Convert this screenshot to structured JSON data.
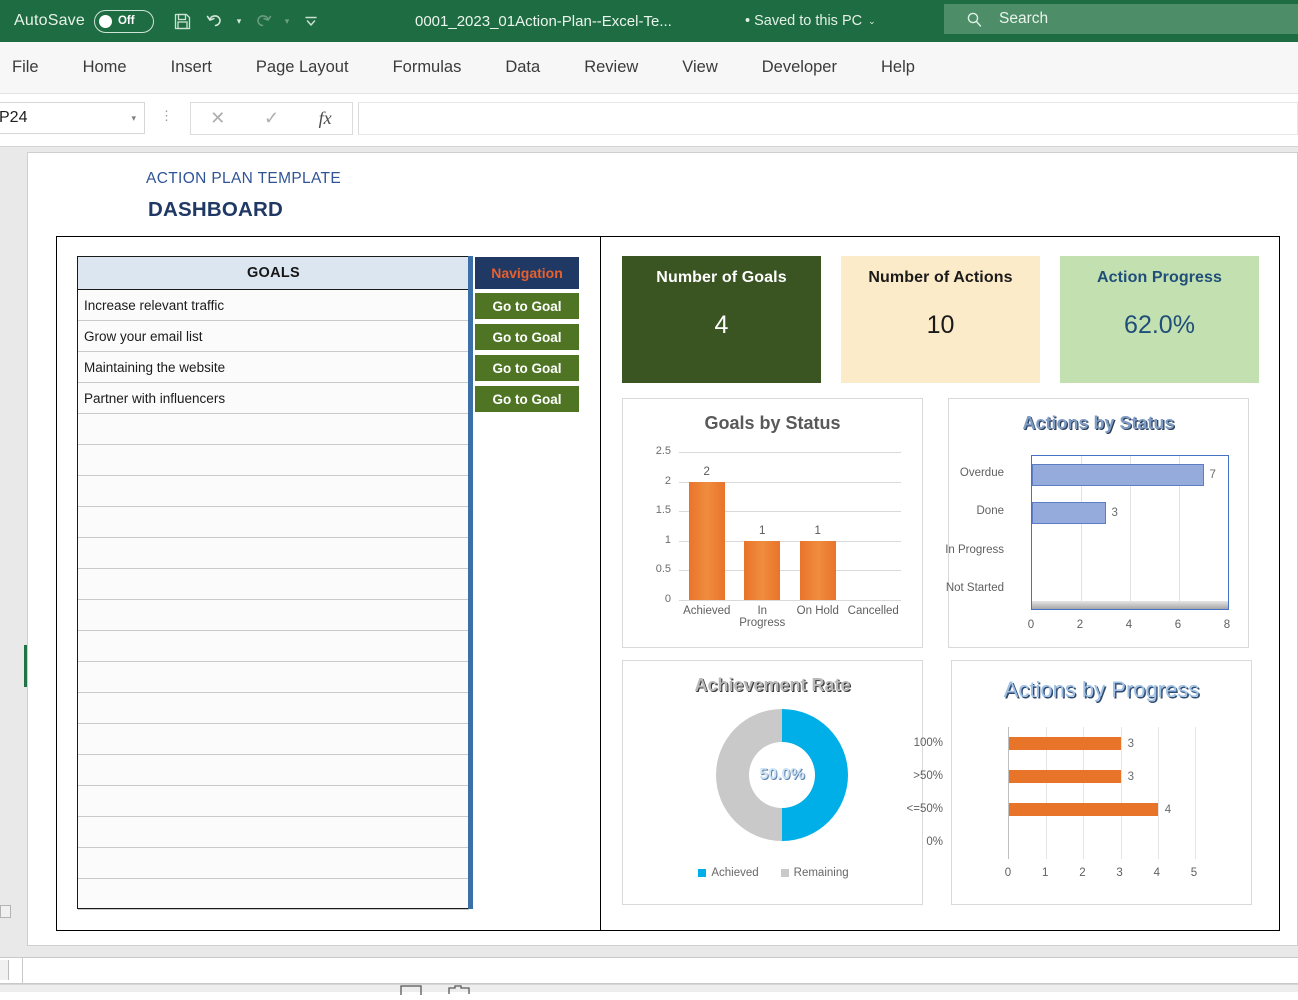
{
  "titlebar": {
    "autosave_label": "AutoSave",
    "autosave_state": "Off",
    "document_title": "0001_2023_01Action-Plan--Excel-Te...",
    "saved_state": "• Saved to this PC",
    "save_icon": "save-icon",
    "undo_icon": "undo-icon",
    "redo_icon": "redo-icon",
    "customize_icon": "customize-quick-access-icon"
  },
  "search": {
    "placeholder": "Search",
    "icon": "search-icon"
  },
  "ribbon": {
    "tabs": [
      {
        "label": "File"
      },
      {
        "label": "Home"
      },
      {
        "label": "Insert"
      },
      {
        "label": "Page Layout"
      },
      {
        "label": "Formulas"
      },
      {
        "label": "Data"
      },
      {
        "label": "Review"
      },
      {
        "label": "View"
      },
      {
        "label": "Developer"
      },
      {
        "label": "Help"
      }
    ]
  },
  "formula_bar": {
    "name_box_value": "P24",
    "cancel_icon": "cancel-icon",
    "enter_icon": "confirm-icon",
    "function_icon": "insert-function-icon",
    "formula_value": ""
  },
  "dashboard": {
    "eyebrow": "ACTION PLAN TEMPLATE",
    "title": "DASHBOARD"
  },
  "goals_panel": {
    "header": "GOALS",
    "nav_header": "Navigation",
    "nav_button_label": "Go to Goal",
    "rows": [
      {
        "goal": "Increase relevant traffic"
      },
      {
        "goal": "Grow your email list"
      },
      {
        "goal": "Maintaining the website"
      },
      {
        "goal": "Partner with influencers"
      }
    ],
    "blank_row_count": 16
  },
  "kpis": [
    {
      "title": "Number of Goals",
      "value": "4",
      "bg": "#3A5422",
      "fg": "#FFFFFF"
    },
    {
      "title": "Number of Actions",
      "value": "10",
      "bg": "#FCEBC8",
      "fg": "#1A1A1A"
    },
    {
      "title": "Action Progress",
      "value": "62.0%",
      "bg": "#C3E0B0",
      "fg": "#1F4E79"
    }
  ],
  "colors": {
    "excel_green": "#1E6C41",
    "navy": "#1F3864",
    "nav_button_green": "#4F7524",
    "nav_header_text": "#E8602C",
    "goals_header_blue": "#DCE6F1",
    "orange_series": "#E8742A",
    "blue_series": "#95ABDB",
    "donut_blue": "#00AEE8",
    "donut_gray": "#C9C9C9"
  },
  "chart_data": [
    {
      "type": "bar",
      "title": "Goals by Status",
      "orientation": "vertical",
      "categories": [
        "Achieved",
        "In Progress",
        "On Hold",
        "Cancelled"
      ],
      "values": [
        2,
        1,
        1,
        0
      ],
      "data_labels": [
        "2",
        "1",
        "1",
        ""
      ],
      "ylim": [
        0,
        2.5
      ],
      "yticks": [
        "0",
        "0.5",
        "1",
        "1.5",
        "2",
        "2.5"
      ],
      "ytick_values": [
        0,
        0.5,
        1,
        1.5,
        2,
        2.5
      ],
      "xlabel": "",
      "ylabel": "",
      "grid": true,
      "legend": "none",
      "series_color": "#E8742A"
    },
    {
      "type": "bar",
      "title": "Actions by Status",
      "orientation": "horizontal",
      "categories": [
        "Not Started",
        "In Progress",
        "Done",
        "Overdue"
      ],
      "values": [
        0,
        0,
        3,
        7
      ],
      "data_labels": [
        "",
        "",
        "3",
        "7"
      ],
      "xlim": [
        0,
        8
      ],
      "xticks": [
        "0",
        "2",
        "4",
        "6",
        "8"
      ],
      "xtick_values": [
        0,
        2,
        4,
        6,
        8
      ],
      "xlabel": "",
      "ylabel": "",
      "grid": true,
      "legend": "none",
      "series_color": "#95ABDB"
    },
    {
      "type": "pie",
      "subtype": "doughnut",
      "title": "Achievement Rate",
      "center_label": "50.0%",
      "labels": [
        "Achieved",
        "Remaining"
      ],
      "values": [
        50,
        50
      ],
      "colors": [
        "#00AEE8",
        "#C9C9C9"
      ],
      "legend": "bottom"
    },
    {
      "type": "bar",
      "title": "Actions by Progress",
      "orientation": "horizontal",
      "categories": [
        "0%",
        "<=50%",
        ">50%",
        "100%"
      ],
      "values": [
        0,
        4,
        3,
        3
      ],
      "data_labels": [
        "",
        "4",
        "3",
        "3"
      ],
      "xlim": [
        0,
        5
      ],
      "xticks": [
        "0",
        "1",
        "2",
        "3",
        "4",
        "5"
      ],
      "xtick_values": [
        0,
        1,
        2,
        3,
        4,
        5
      ],
      "xlabel": "",
      "ylabel": "",
      "grid": true,
      "legend": "none",
      "series_color": "#E8742A"
    }
  ]
}
